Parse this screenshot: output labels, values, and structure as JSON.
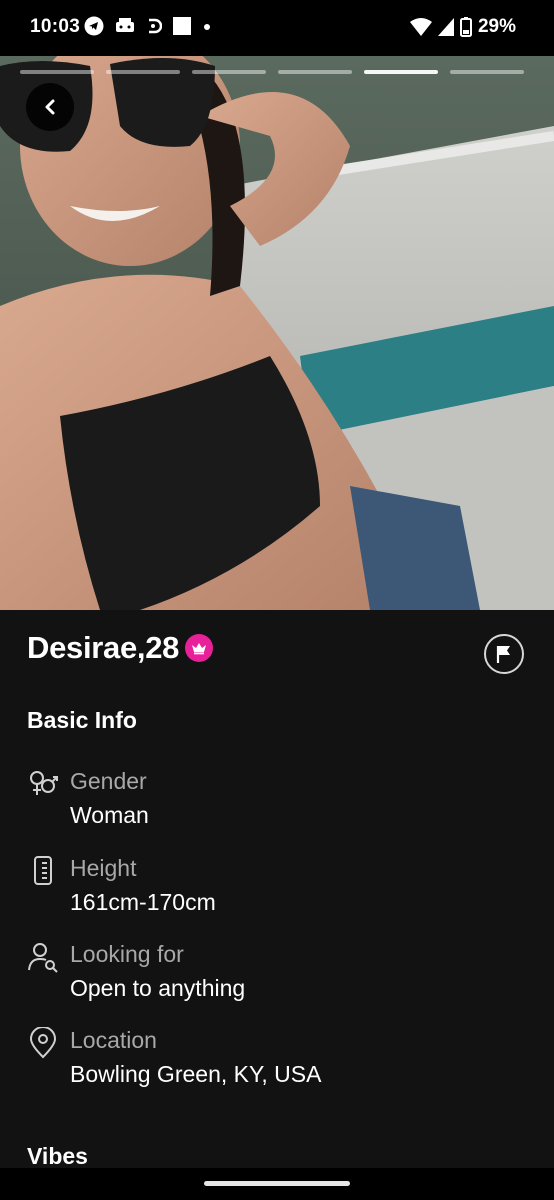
{
  "status_bar": {
    "time": "10:03",
    "battery": "29%",
    "icons_left": [
      "telegram-icon",
      "wallet-icon",
      "d-icon",
      "square-icon",
      "dot-icon"
    ],
    "icons_right": [
      "wifi-icon",
      "signal-icon",
      "battery-icon"
    ]
  },
  "photo": {
    "story_count": 6,
    "active_index": 4
  },
  "profile": {
    "name_age": "Desirae,28",
    "badge": "crown-icon",
    "accent": "#e8219a"
  },
  "basic_info": {
    "title": "Basic Info",
    "items": [
      {
        "icon": "gender-icon",
        "label": "Gender",
        "value": "Woman"
      },
      {
        "icon": "height-icon",
        "label": "Height",
        "value": "161cm-170cm"
      },
      {
        "icon": "looking-for-icon",
        "label": "Looking for",
        "value": "Open to anything"
      },
      {
        "icon": "location-pin-icon",
        "label": "Location",
        "value": "Bowling Green, KY, USA"
      }
    ]
  },
  "vibes": {
    "title": "Vibes"
  }
}
